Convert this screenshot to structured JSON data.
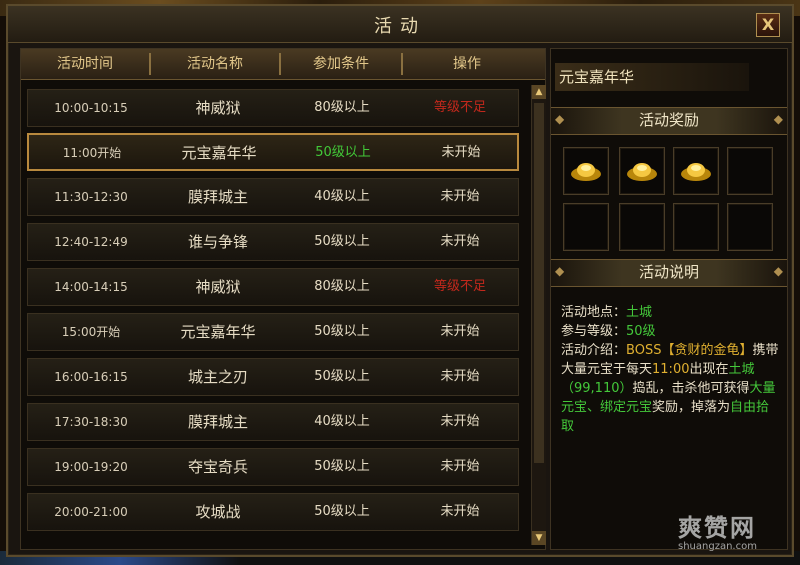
{
  "window": {
    "title": "活动",
    "close_label": "X"
  },
  "table": {
    "headers": [
      "活动时间",
      "活动名称",
      "参加条件",
      "操作"
    ],
    "rows": [
      {
        "time": "10:00-10:15",
        "name": "神威狱",
        "cond": "80级以上",
        "op": "等级不足"
      },
      {
        "time": "11:00开始",
        "name": "元宝嘉年华",
        "cond": "50级以上",
        "op": "未开始"
      },
      {
        "time": "11:30-12:30",
        "name": "膜拜城主",
        "cond": "40级以上",
        "op": "未开始"
      },
      {
        "time": "12:40-12:49",
        "name": "谁与争锋",
        "cond": "50级以上",
        "op": "未开始"
      },
      {
        "time": "14:00-14:15",
        "name": "神威狱",
        "cond": "80级以上",
        "op": "等级不足"
      },
      {
        "time": "15:00开始",
        "name": "元宝嘉年华",
        "cond": "50级以上",
        "op": "未开始"
      },
      {
        "time": "16:00-16:15",
        "name": "城主之刃",
        "cond": "50级以上",
        "op": "未开始"
      },
      {
        "time": "17:30-18:30",
        "name": "膜拜城主",
        "cond": "40级以上",
        "op": "未开始"
      },
      {
        "time": "19:00-19:20",
        "name": "夺宝奇兵",
        "cond": "50级以上",
        "op": "未开始"
      },
      {
        "time": "20:00-21:00",
        "name": "攻城战",
        "cond": "50级以上",
        "op": "未开始"
      }
    ]
  },
  "details": {
    "activity_name": "元宝嘉年华",
    "rewards_header": "活动奖励",
    "description_header": "活动说明",
    "location_label": "活动地点：",
    "location_value": "土城",
    "level_label": "参与等级：",
    "level_value": "50级",
    "intro_label": "活动介绍：",
    "intro_boss": "BOSS【贪财的金龟】",
    "intro_text1": "携带大量元宝于每天",
    "intro_time": "11:00",
    "intro_text2": "出现在",
    "intro_place": "土城（99,110）",
    "intro_text3": "捣乱，击杀他可获得",
    "intro_reward": "大量元宝、绑定元宝",
    "intro_text4": "奖励，掉落为",
    "intro_pickup": "自由拾取"
  },
  "watermark": {
    "logo": "爽赞网",
    "url": "shuangzan.com"
  }
}
